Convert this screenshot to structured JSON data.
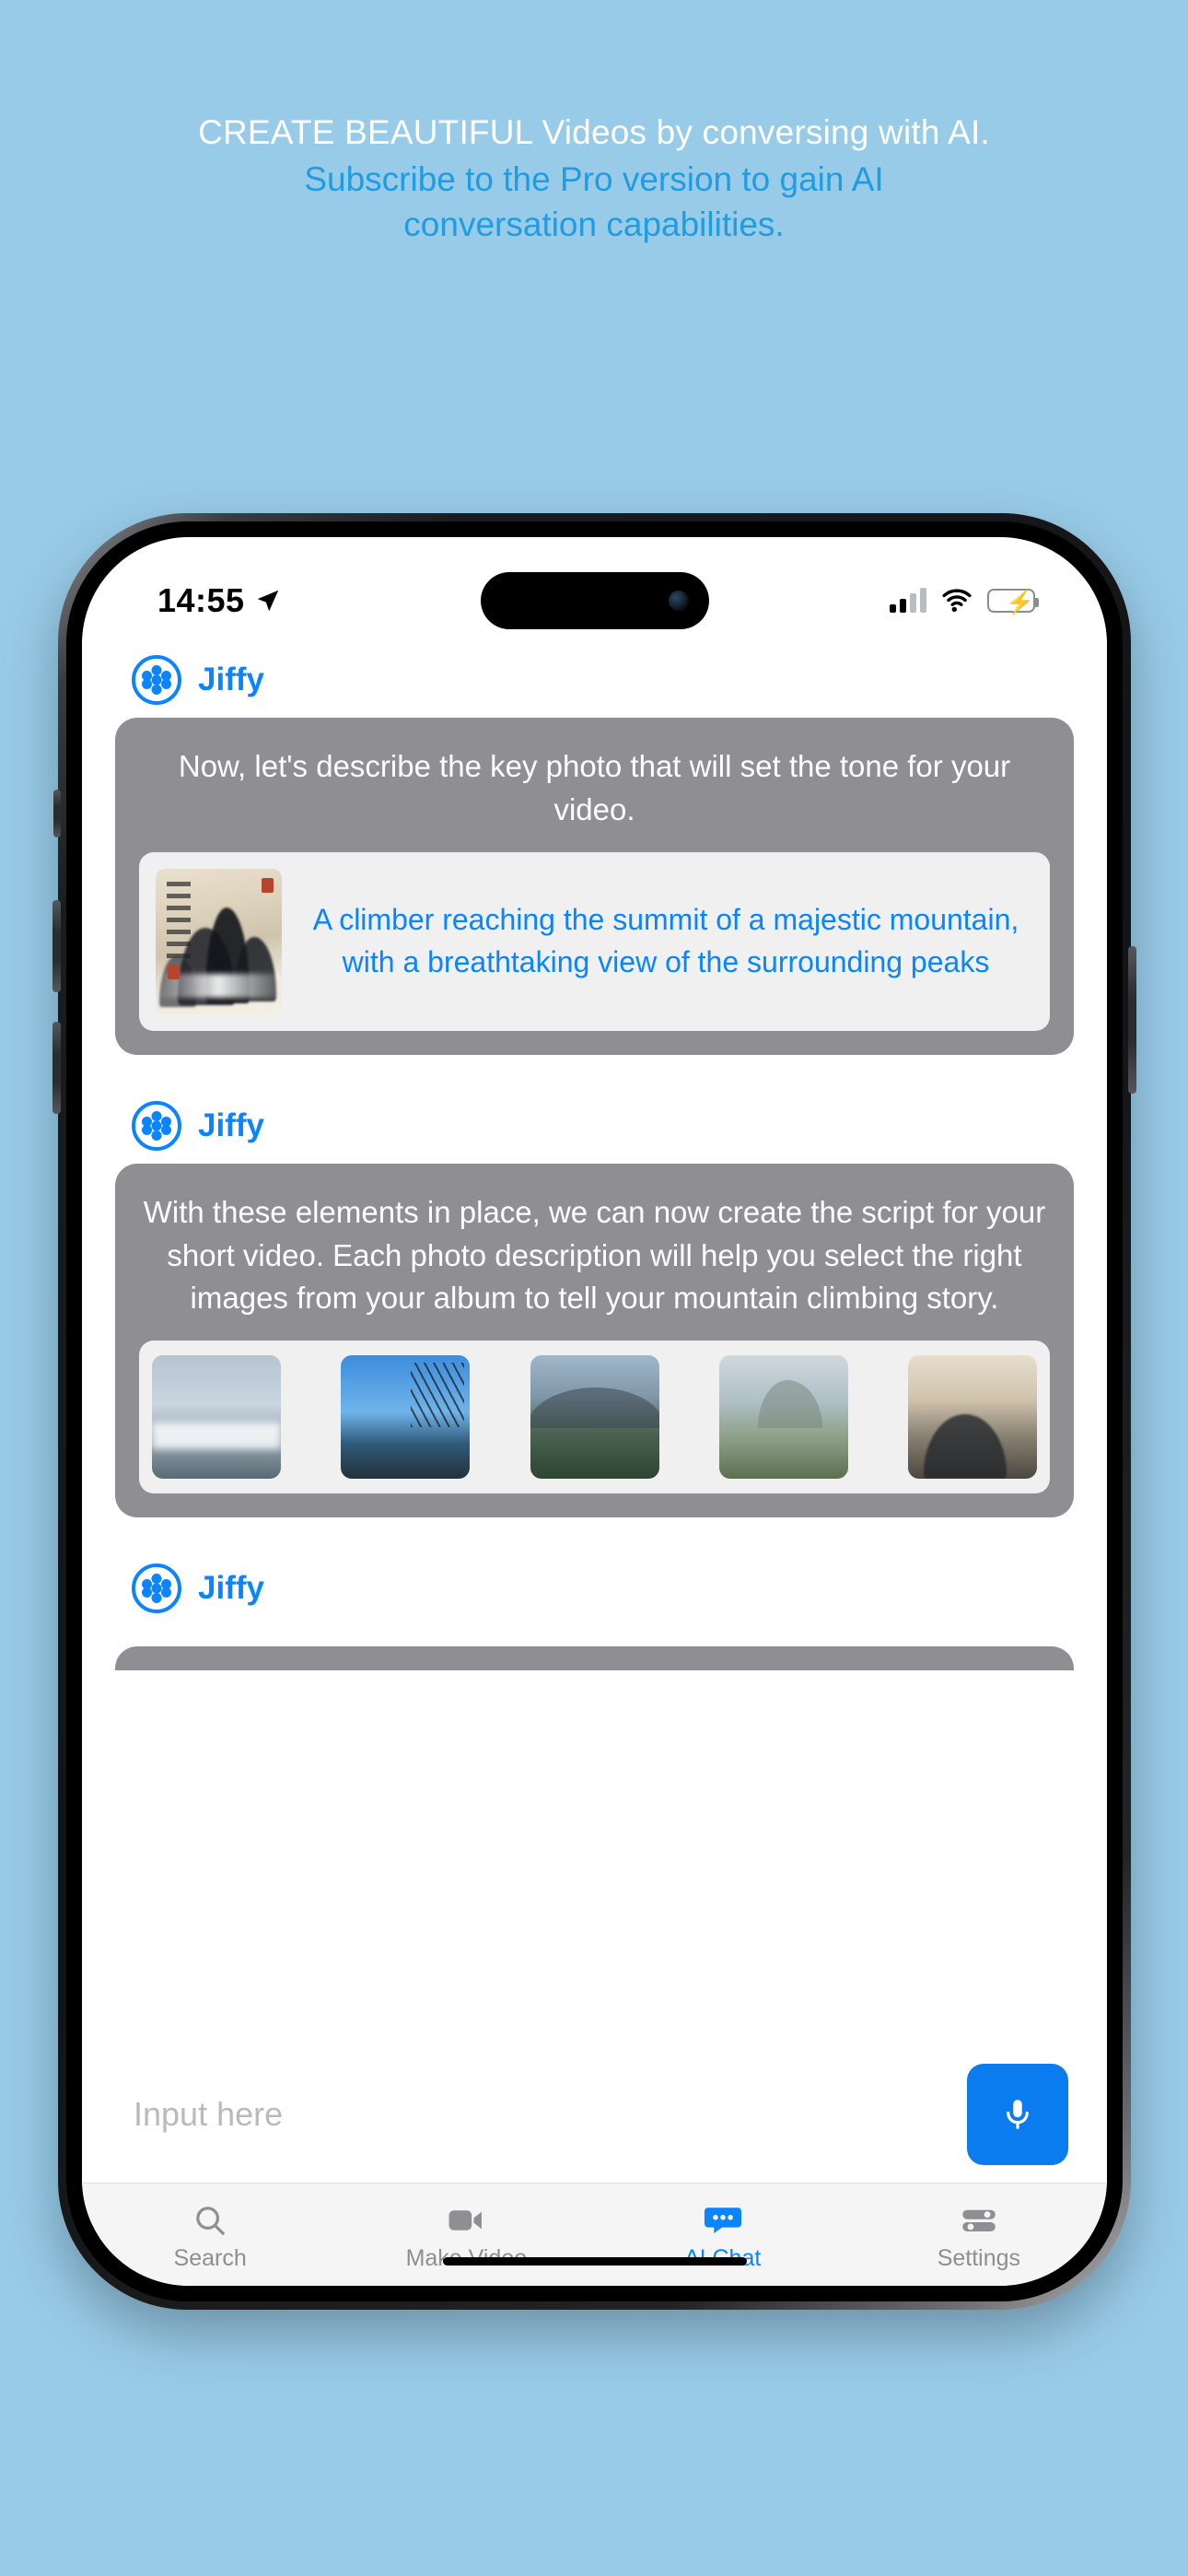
{
  "promo": {
    "line1": "CREATE BEAUTIFUL Videos by conversing with AI.",
    "line2": "Subscribe to the Pro version to gain AI conversation capabilities."
  },
  "status_bar": {
    "time": "14:55",
    "location_icon": "location-arrow-icon",
    "signal_icon": "cellular-signal-icon",
    "wifi_icon": "wifi-icon",
    "battery_icon": "battery-charging-icon"
  },
  "app": {
    "assistant_name": "Jiffy",
    "logo_icon": "jiffy-flower-logo-icon"
  },
  "messages": [
    {
      "sender": "Jiffy",
      "text": "Now, let's describe the key photo that will set the tone for your video.",
      "card": {
        "thumbnail_alt": "chinese-ink-mountain-painting",
        "description": "A climber reaching the summit of a majestic mountain, with a breathtaking view of the surrounding peaks"
      }
    },
    {
      "sender": "Jiffy",
      "text": "With these elements in place, we can now create the script for your short video. Each photo description will help you select the right images from your album to tell your mountain climbing story.",
      "photos": [
        "misty-cliff-above-clouds",
        "blue-sky-with-bare-tree",
        "rocky-mountain-and-forest",
        "valley-river-with-mountains",
        "ink-wash-mountain-scene"
      ]
    },
    {
      "sender": "Jiffy",
      "text": ""
    }
  ],
  "input": {
    "placeholder": "Input here",
    "value": "",
    "mic_icon": "microphone-icon"
  },
  "tabs": [
    {
      "label": "Search",
      "icon": "search-icon",
      "active": false
    },
    {
      "label": "Make Video",
      "icon": "video-camera-icon",
      "active": false
    },
    {
      "label": "AI Chat",
      "icon": "chat-bubble-icon",
      "active": true
    },
    {
      "label": "Settings",
      "icon": "sliders-icon",
      "active": false
    }
  ],
  "colors": {
    "background": "#98cbe8",
    "accent": "#0a84ff",
    "promo_link": "#1f9ce4",
    "bubble": "#8e8e93",
    "inner_card": "#f0f0f0",
    "tab_inactive": "#8e8e93"
  }
}
